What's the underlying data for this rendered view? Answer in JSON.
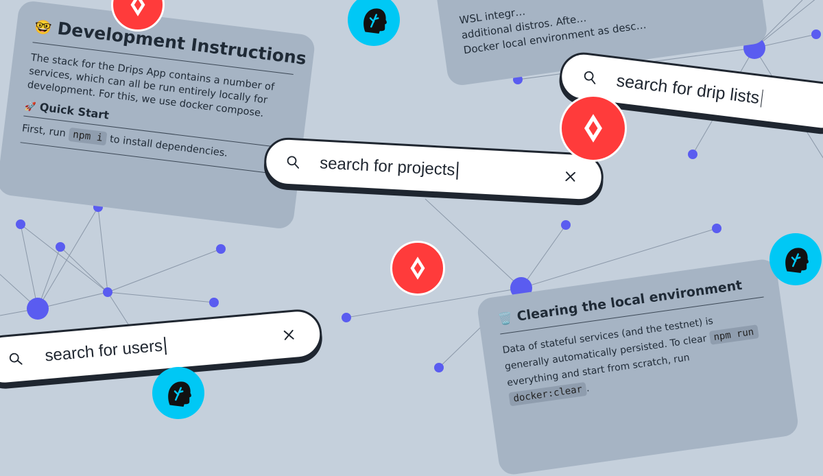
{
  "colors": {
    "background": "#c5d0dc",
    "card": "#a6b4c4",
    "node": "#5a5cf0",
    "drips_red": "#ff3b3b",
    "radicle_cyan": "#00c8f5"
  },
  "dev_card": {
    "emoji": "🤓",
    "title": "Development Instructions",
    "body": [
      "The stack for the Drips App contains a number of",
      "services, which can all be run entirely locally for",
      "development. For this, we use docker compose."
    ],
    "quickstart_emoji": "🚀",
    "quickstart": "Quick Start",
    "first_run_prefix": "First, run",
    "first_run_code": "npm i",
    "first_run_suffix": "to install dependencies."
  },
  "wsl_card": {
    "lines": [
      "WSL integr…",
      "additional distros. Afte…",
      "Docker local environment as desc…"
    ]
  },
  "clear_card": {
    "emoji": "🗑️",
    "title": "Clearing the local environment",
    "line1": "Data of stateful services (and the testnet) is",
    "line2_prefix": "generally automatically persisted. To clear",
    "code1": "npm run",
    "line3": "everything and start from scratch, run",
    "code2": "docker:clear",
    "period": "."
  },
  "searches": {
    "projects": "search for projects",
    "drip_lists": "search for drip lists",
    "users": "search for users"
  },
  "icons": [
    "search-icon",
    "close-icon",
    "drips-logo",
    "radicle-head-logo"
  ]
}
